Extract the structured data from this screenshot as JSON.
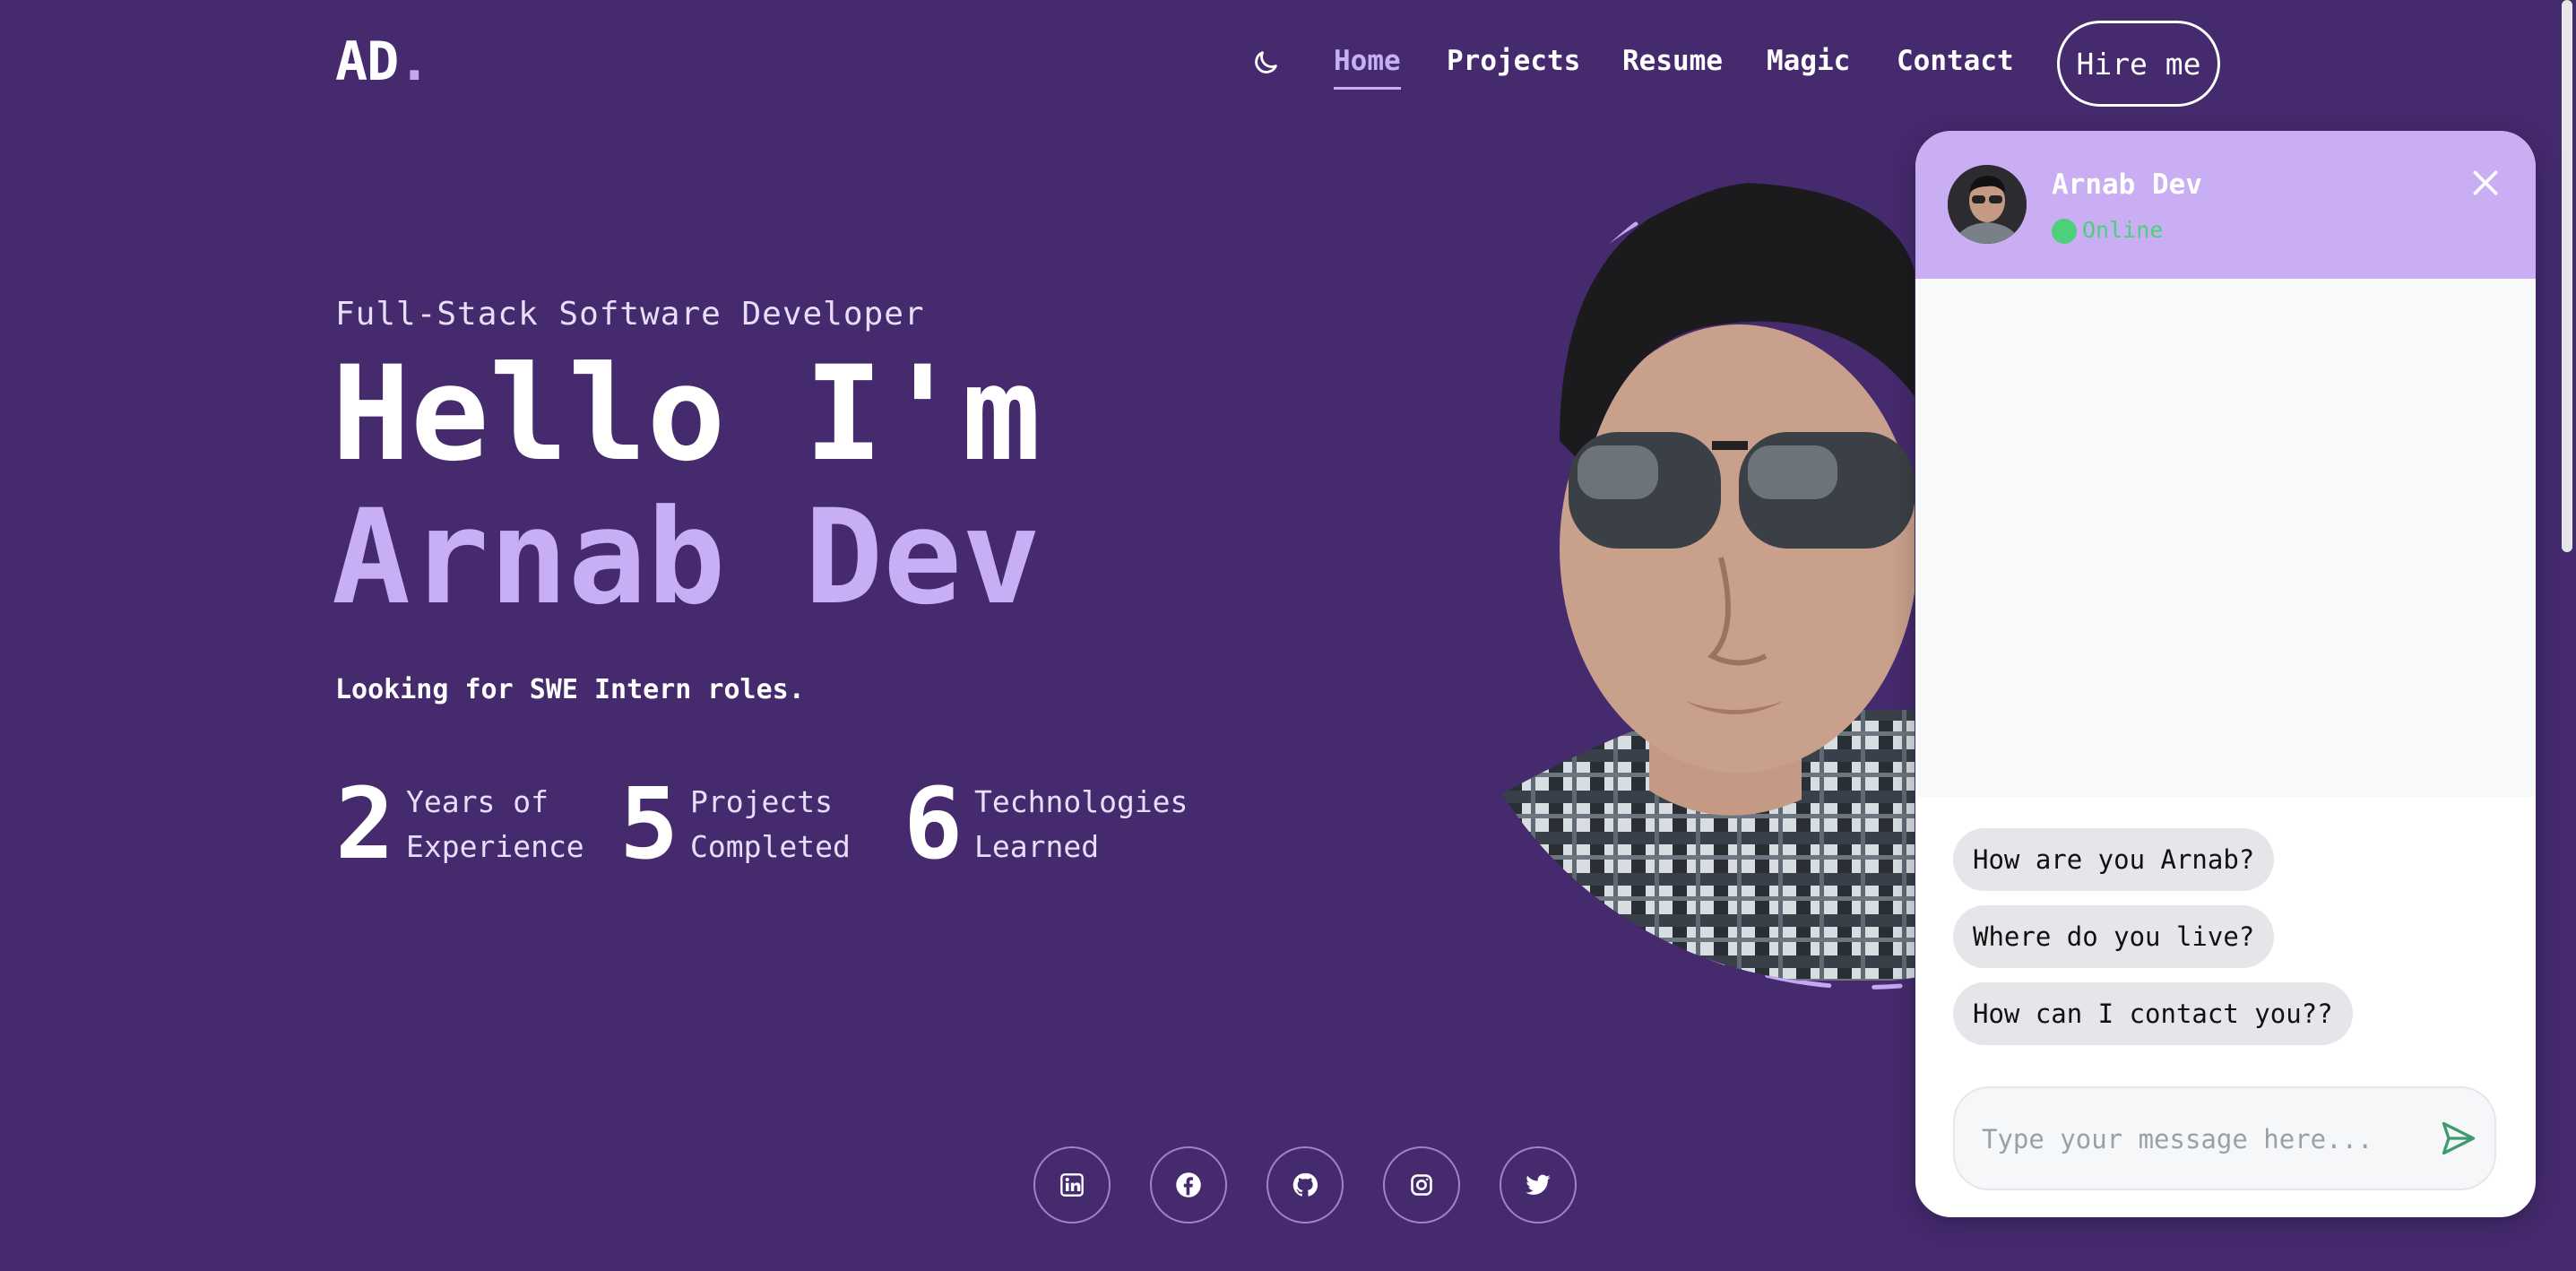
{
  "header": {
    "logo_text": "AD",
    "logo_dot": ".",
    "theme_icon": "moon-icon",
    "nav": [
      {
        "label": "Home",
        "active": true
      },
      {
        "label": "Projects",
        "active": false
      },
      {
        "label": "Resume",
        "active": false
      },
      {
        "label": "Magic",
        "active": false
      },
      {
        "label": "Contact",
        "active": false
      }
    ],
    "hire_label": "Hire me"
  },
  "hero": {
    "role": "Full-Stack Software Developer",
    "greeting": "Hello I'm",
    "name": "Arnab Dev",
    "tagline": "Looking for SWE Intern roles.",
    "stats": [
      {
        "value": "2",
        "label_line1": "Years of",
        "label_line2": "Experience"
      },
      {
        "value": "5",
        "label_line1": "Projects",
        "label_line2": "Completed"
      },
      {
        "value": "6",
        "label_line1": "Technologies",
        "label_line2": "Learned"
      }
    ]
  },
  "socials": [
    "linkedin-icon",
    "facebook-icon",
    "github-icon",
    "instagram-icon",
    "twitter-icon"
  ],
  "chat": {
    "name": "Arnab Dev",
    "status": "Online",
    "suggestions": [
      "How are you Arnab?",
      "Where do you live?",
      "How can I contact you??"
    ],
    "input_placeholder": "Type your message here..."
  },
  "colors": {
    "background": "#452a6e",
    "accent": "#c8aef4",
    "chat_header": "#c9aef3",
    "online": "#4cd07a"
  }
}
